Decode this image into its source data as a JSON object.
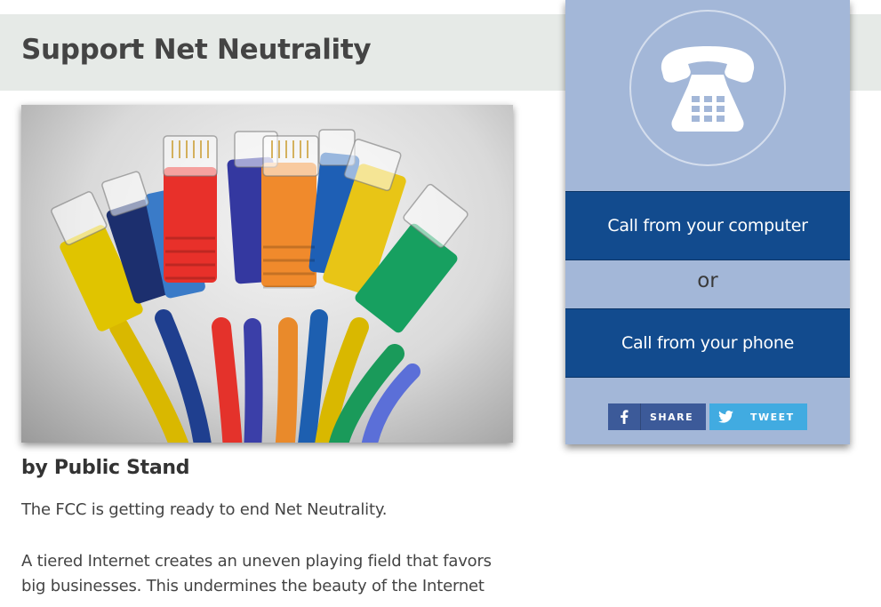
{
  "page": {
    "title": "Support Net Neutrality",
    "byline": "by Public Stand",
    "paragraphs": [
      "The FCC is getting ready to end Net Neutrality.",
      "A tiered Internet creates an uneven playing field that favors",
      "big businesses. This undermines the beauty of the Internet"
    ]
  },
  "widget": {
    "call_computer_label": "Call from your computer",
    "or_label": "or",
    "call_phone_label": "Call from your phone",
    "share_label": "SHARE",
    "tweet_label": "TWEET",
    "icons": [
      "telephone-icon",
      "facebook-icon",
      "twitter-icon"
    ]
  },
  "colors": {
    "title_bar": "#e6eae7",
    "widget_bg": "#a3b7d8",
    "button_blue": "#124b8e",
    "facebook": "#3c5a99",
    "twitter": "#41abe1"
  }
}
